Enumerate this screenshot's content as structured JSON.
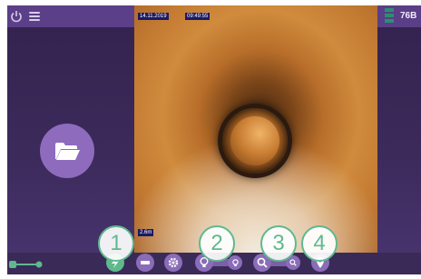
{
  "topbar": {
    "battery_level": "76B",
    "icons": [
      "power-icon",
      "menu-icon",
      "signal-icon"
    ]
  },
  "video": {
    "date": "14.11.2019",
    "time": "09:49:55",
    "distance": "2.6m"
  },
  "toolbar": {
    "buttons": [
      "light-icon",
      "minus-icon",
      "gear-icon",
      "bulb-icon",
      "zoom-icon",
      "location-icon"
    ]
  },
  "callouts": [
    "1",
    "2",
    "3",
    "4"
  ],
  "colors": {
    "accent": "#5fb98d",
    "purple": "#8e6bbd",
    "panel": "#3c2a5b"
  }
}
